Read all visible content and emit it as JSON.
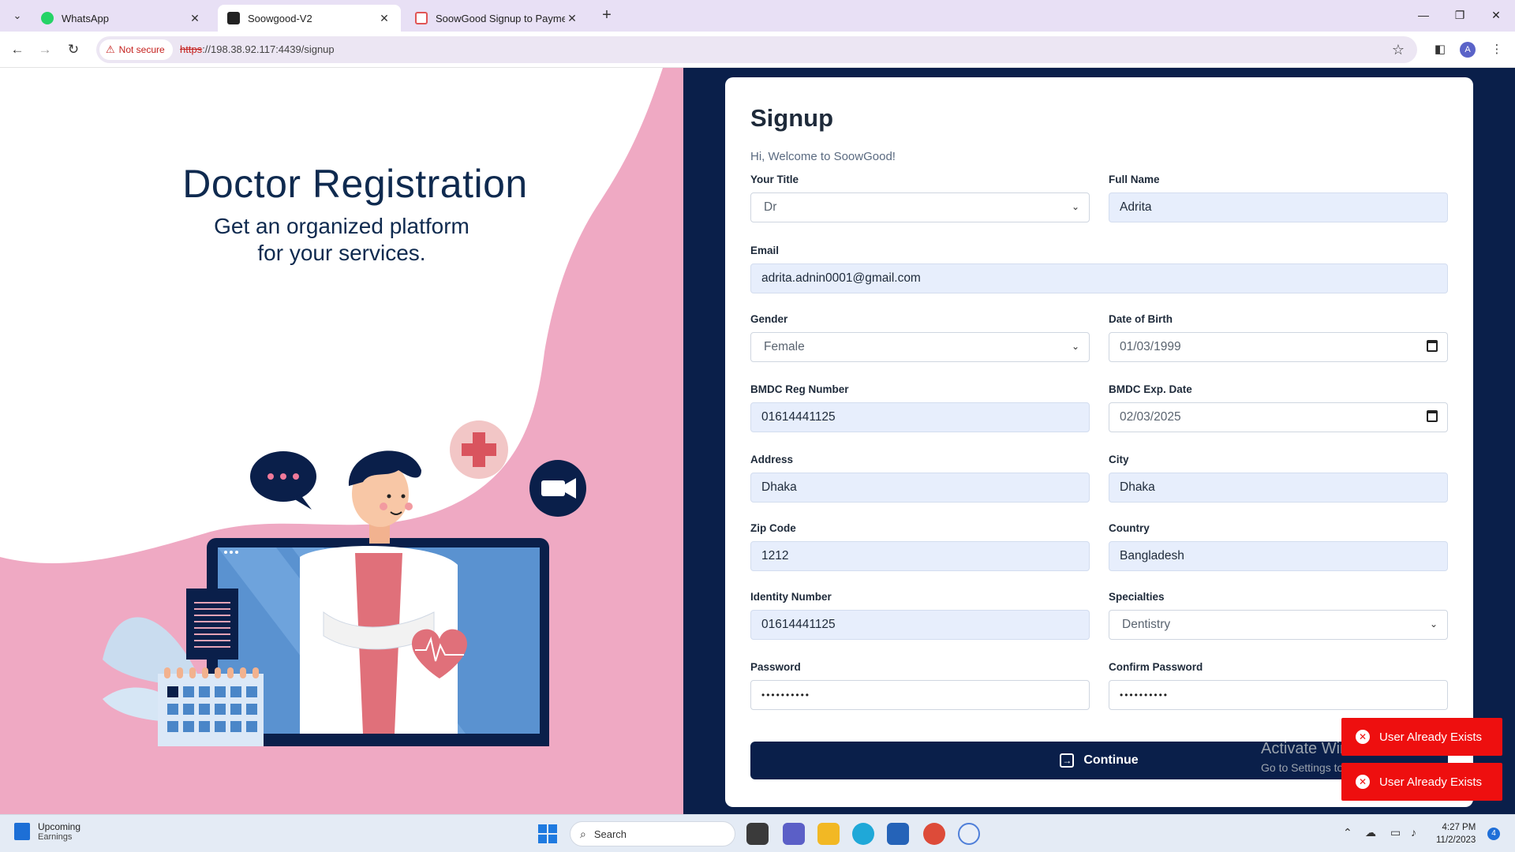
{
  "browser": {
    "tabs": [
      {
        "label": "WhatsApp",
        "icon": "whatsapp-icon"
      },
      {
        "label": "Soowgood-V2",
        "icon": "angular-icon"
      },
      {
        "label": "SoowGood Signup to Payment",
        "icon": "doc-icon"
      }
    ],
    "security_label": "Not secure",
    "url_scheme": "https",
    "url_rest": "://198.38.92.117:4439/signup",
    "profile_initial": "A"
  },
  "hero": {
    "title": "Doctor Registration",
    "subtitle_line1": "Get an organized platform",
    "subtitle_line2": "for your services."
  },
  "form": {
    "title": "Signup",
    "welcome": "Hi, Welcome to SoowGood!",
    "fields": {
      "title": {
        "label": "Your Title",
        "value": "Dr"
      },
      "full_name": {
        "label": "Full Name",
        "value": "Adrita"
      },
      "email": {
        "label": "Email",
        "value": "adrita.adnin0001@gmail.com"
      },
      "gender": {
        "label": "Gender",
        "value": "Female"
      },
      "dob": {
        "label": "Date of Birth",
        "value": "01/03/1999"
      },
      "bmdc_reg": {
        "label": "BMDC Reg Number",
        "value": "01614441125"
      },
      "bmdc_exp": {
        "label": "BMDC Exp. Date",
        "value": "02/03/2025"
      },
      "address": {
        "label": "Address",
        "value": "Dhaka"
      },
      "city": {
        "label": "City",
        "value": "Dhaka"
      },
      "zip": {
        "label": "Zip Code",
        "value": "1212"
      },
      "country": {
        "label": "Country",
        "value": "Bangladesh"
      },
      "identity": {
        "label": "Identity Number",
        "value": "01614441125"
      },
      "specialties": {
        "label": "Specialties",
        "value": "Dentistry"
      },
      "password": {
        "label": "Password",
        "value": "••••••••••"
      },
      "confirm_password": {
        "label": "Confirm Password",
        "value": "••••••••••"
      }
    },
    "continue_label": "Continue"
  },
  "toasts": [
    "User Already Exists",
    "User Already Exists"
  ],
  "watermark": {
    "line1": "Activate Windows",
    "line2": "Go to Settings to activate Windows."
  },
  "taskbar": {
    "widget_title": "Upcoming",
    "widget_subtitle": "Earnings",
    "search_label": "Search",
    "time": "4:27 PM",
    "date": "11/2/2023",
    "notification_count": "4"
  },
  "colors": {
    "navy": "#0a1f4a",
    "pink": "#efa9c3",
    "input_fill": "#e7eefc",
    "toast_red": "#ee0f0f"
  }
}
